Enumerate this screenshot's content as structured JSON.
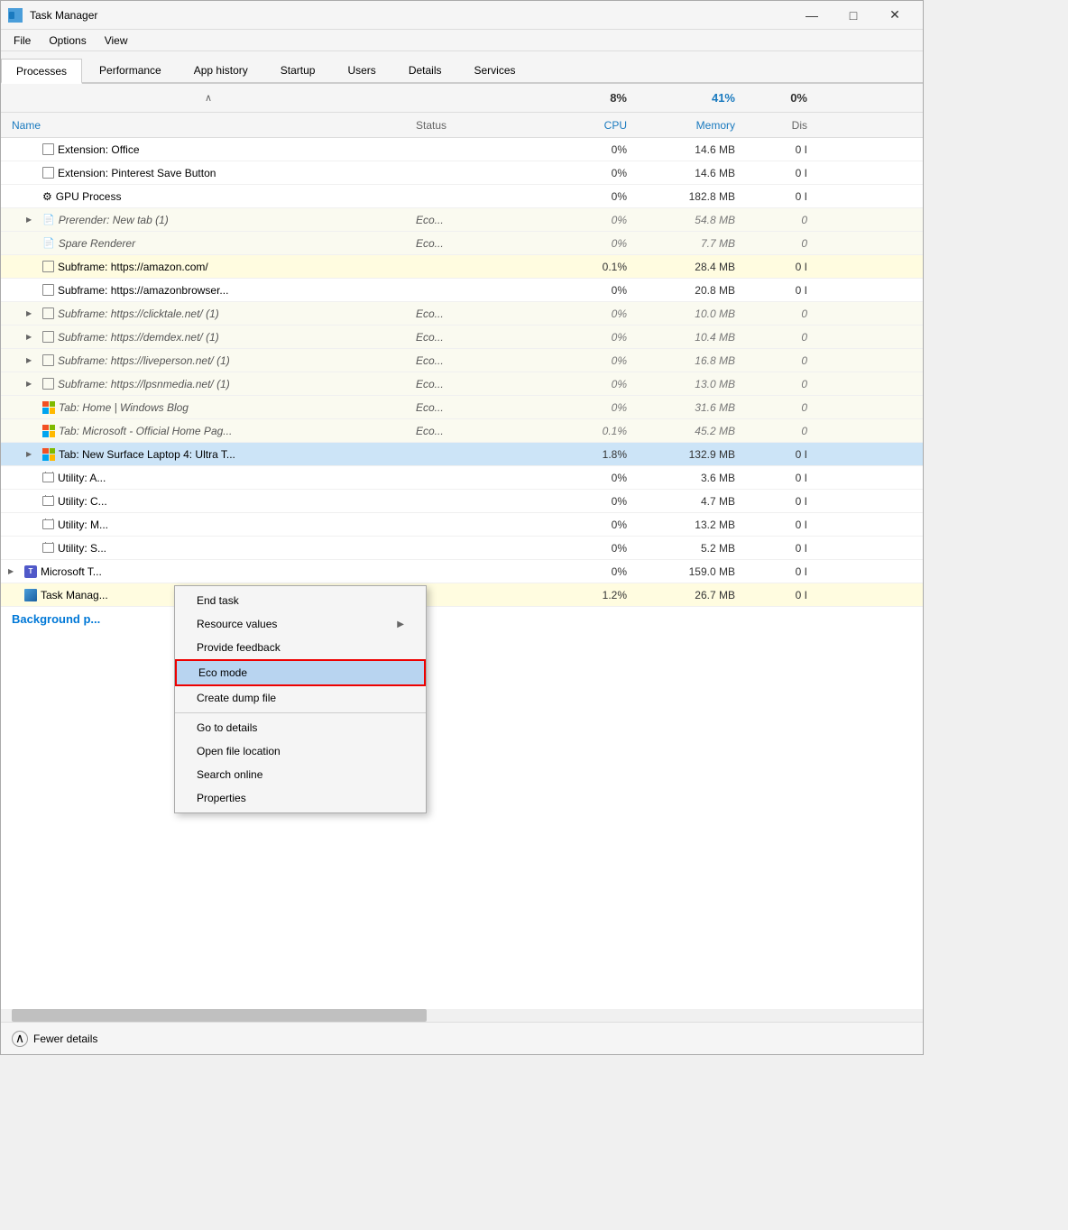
{
  "window": {
    "title": "Task Manager",
    "min_label": "—",
    "max_label": "□",
    "close_label": "✕"
  },
  "menu": {
    "items": [
      "File",
      "Options",
      "View"
    ]
  },
  "tabs": {
    "items": [
      "Processes",
      "Performance",
      "App history",
      "Startup",
      "Users",
      "Details",
      "Services"
    ],
    "active": "Processes"
  },
  "sort_row": {
    "cpu_pct": "8%",
    "mem_pct": "41%",
    "dis_pct": "0%"
  },
  "headers": {
    "name": "Name",
    "status": "Status",
    "cpu": "CPU",
    "memory": "Memory",
    "disk": "Dis"
  },
  "processes": [
    {
      "indent": 1,
      "icon": "box",
      "name": "Extension: Office",
      "status": "",
      "cpu": "0%",
      "mem": "14.6 MB",
      "dis": "0 I",
      "bg": ""
    },
    {
      "indent": 1,
      "icon": "box",
      "name": "Extension: Pinterest Save Button",
      "status": "",
      "cpu": "0%",
      "mem": "14.6 MB",
      "dis": "0 I",
      "bg": ""
    },
    {
      "indent": 1,
      "icon": "gear",
      "name": "GPU Process",
      "status": "",
      "cpu": "0%",
      "mem": "182.8 MB",
      "dis": "0 I",
      "bg": ""
    },
    {
      "indent": 1,
      "expand": true,
      "icon": "page",
      "name": "Prerender: New tab (1)",
      "status": "Eco...",
      "cpu": "0%",
      "mem": "54.8 MB",
      "dis": "0",
      "bg": "eco"
    },
    {
      "indent": 1,
      "icon": "page",
      "name": "Spare Renderer",
      "status": "Eco...",
      "cpu": "0%",
      "mem": "7.7 MB",
      "dis": "0",
      "bg": "eco"
    },
    {
      "indent": 1,
      "icon": "box",
      "name": "Subframe: https://amazon.com/",
      "status": "",
      "cpu": "0.1%",
      "mem": "28.4 MB",
      "dis": "0 I",
      "bg": "yellow"
    },
    {
      "indent": 1,
      "icon": "box",
      "name": "Subframe: https://amazonbrowser...",
      "status": "",
      "cpu": "0%",
      "mem": "20.8 MB",
      "dis": "0 I",
      "bg": ""
    },
    {
      "indent": 1,
      "expand": true,
      "icon": "box",
      "name": "Subframe: https://clicktale.net/ (1)",
      "status": "Eco...",
      "cpu": "0%",
      "mem": "10.0 MB",
      "dis": "0",
      "bg": "eco"
    },
    {
      "indent": 1,
      "expand": true,
      "icon": "box",
      "name": "Subframe: https://demdex.net/ (1)",
      "status": "Eco...",
      "cpu": "0%",
      "mem": "10.4 MB",
      "dis": "0",
      "bg": "eco"
    },
    {
      "indent": 1,
      "expand": true,
      "icon": "box",
      "name": "Subframe: https://liveperson.net/ (1)",
      "status": "Eco...",
      "cpu": "0%",
      "mem": "16.8 MB",
      "dis": "0",
      "bg": "eco"
    },
    {
      "indent": 1,
      "expand": true,
      "icon": "box",
      "name": "Subframe: https://lpsnmedia.net/ (1)",
      "status": "Eco...",
      "cpu": "0%",
      "mem": "13.0 MB",
      "dis": "0",
      "bg": "eco"
    },
    {
      "indent": 1,
      "icon": "win",
      "name": "Tab: Home | Windows Blog",
      "status": "Eco...",
      "cpu": "0%",
      "mem": "31.6 MB",
      "dis": "0",
      "bg": "eco"
    },
    {
      "indent": 1,
      "icon": "win",
      "name": "Tab: Microsoft - Official Home Pag...",
      "status": "Eco...",
      "cpu": "0.1%",
      "mem": "45.2 MB",
      "dis": "0",
      "bg": "eco"
    },
    {
      "indent": 1,
      "expand": true,
      "icon": "win",
      "name": "Tab: New Surface Laptop 4: Ultra T...",
      "status": "",
      "cpu": "1.8%",
      "mem": "132.9 MB",
      "dis": "0 I",
      "bg": "selected"
    },
    {
      "indent": 1,
      "icon": "suitcase",
      "name": "Utility: A...",
      "status": "",
      "cpu": "0%",
      "mem": "3.6 MB",
      "dis": "0 I",
      "bg": ""
    },
    {
      "indent": 1,
      "icon": "suitcase",
      "name": "Utility: C...",
      "status": "",
      "cpu": "0%",
      "mem": "4.7 MB",
      "dis": "0 I",
      "bg": ""
    },
    {
      "indent": 1,
      "icon": "suitcase",
      "name": "Utility: M...",
      "status": "",
      "cpu": "0%",
      "mem": "13.2 MB",
      "dis": "0 I",
      "bg": ""
    },
    {
      "indent": 1,
      "icon": "suitcase",
      "name": "Utility: S...",
      "status": "",
      "cpu": "0%",
      "mem": "5.2 MB",
      "dis": "0 I",
      "bg": ""
    },
    {
      "indent": 0,
      "expand": true,
      "icon": "teams",
      "name": "Microsoft T...",
      "status": "",
      "cpu": "0%",
      "mem": "159.0 MB",
      "dis": "0 I",
      "bg": ""
    },
    {
      "indent": 0,
      "expand": false,
      "icon": "taskmgr",
      "name": "Task Manag...",
      "status": "",
      "cpu": "1.2%",
      "mem": "26.7 MB",
      "dis": "0 I",
      "bg": "yellow"
    }
  ],
  "bg_processes_label": "Background p...",
  "context_menu": {
    "items": [
      {
        "id": "end-task",
        "label": "End task",
        "has_arrow": false,
        "highlighted": false,
        "separator_after": false
      },
      {
        "id": "resource-values",
        "label": "Resource values",
        "has_arrow": true,
        "highlighted": false,
        "separator_after": false
      },
      {
        "id": "provide-feedback",
        "label": "Provide feedback",
        "has_arrow": false,
        "highlighted": false,
        "separator_after": false
      },
      {
        "id": "eco-mode",
        "label": "Eco mode",
        "has_arrow": false,
        "highlighted": true,
        "separator_after": false
      },
      {
        "id": "create-dump",
        "label": "Create dump file",
        "has_arrow": false,
        "highlighted": false,
        "separator_after": false
      },
      {
        "id": "go-to-details",
        "label": "Go to details",
        "has_arrow": false,
        "highlighted": false,
        "separator_after": false
      },
      {
        "id": "open-file-location",
        "label": "Open file location",
        "has_arrow": false,
        "highlighted": false,
        "separator_after": false
      },
      {
        "id": "search-online",
        "label": "Search online",
        "has_arrow": false,
        "highlighted": false,
        "separator_after": false
      },
      {
        "id": "properties",
        "label": "Properties",
        "has_arrow": false,
        "highlighted": false,
        "separator_after": false
      }
    ]
  },
  "bottom_bar": {
    "fewer_details_label": "Fewer details",
    "chevron_char": "⌃"
  }
}
